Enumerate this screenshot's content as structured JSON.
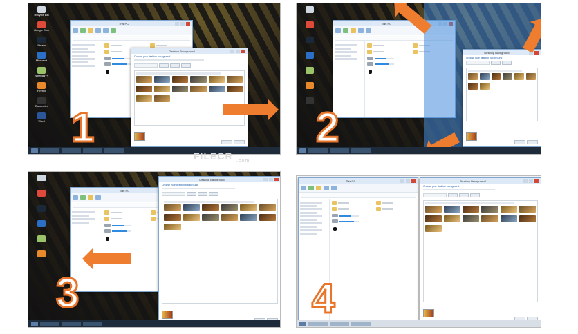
{
  "panels": [
    {
      "step": "1",
      "desktop_icons": [
        "Recycle Bin",
        "Google Chrome",
        "Steam",
        "Microsoft",
        "Notepad++",
        "Firefox",
        "Rainmeter",
        "Word"
      ]
    },
    {
      "step": "2"
    },
    {
      "step": "3"
    },
    {
      "step": "4"
    }
  ],
  "explorer": {
    "title": "This PC"
  },
  "dialog": {
    "title": "Desktop Background",
    "heading": "Choose your desktop background"
  },
  "watermark": {
    "brand": "FILECR",
    "tld": ".com"
  },
  "colors": {
    "accent": "#ef7d30",
    "snap_overlay": "#468cdc",
    "taskbar": "#1d2b3a"
  }
}
